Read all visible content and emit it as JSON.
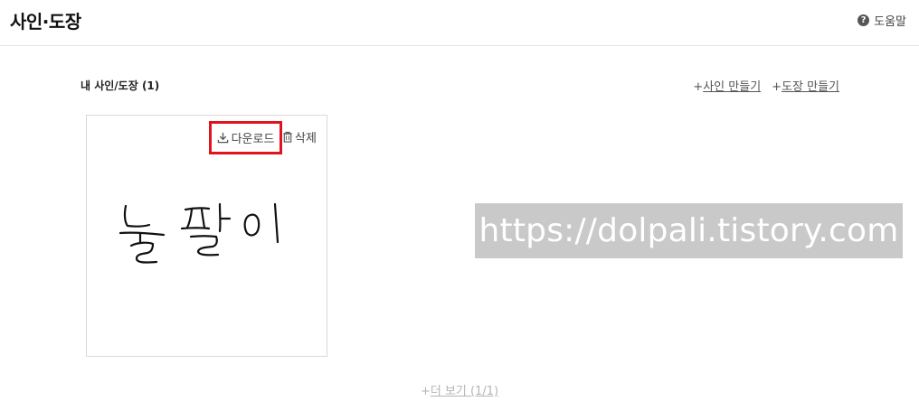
{
  "header": {
    "title": "사인·도장",
    "help_label": "도움말",
    "help_icon": "question-circle-icon"
  },
  "section": {
    "title": "내 사인/도장 (1)",
    "create_sign_label": "사인 만들기",
    "create_stamp_label": "도장 만들기",
    "plus": "+"
  },
  "card": {
    "download_label": "다운로드",
    "download_icon": "download-icon",
    "delete_label": "삭제",
    "delete_icon": "trash-icon",
    "signature_text": "돌팔이",
    "highlight_color": "#e0141f"
  },
  "watermark": {
    "text": "https://dolpali.tistory.com"
  },
  "footer": {
    "plus": "+",
    "more_label": "더 보기 (1/1)"
  }
}
